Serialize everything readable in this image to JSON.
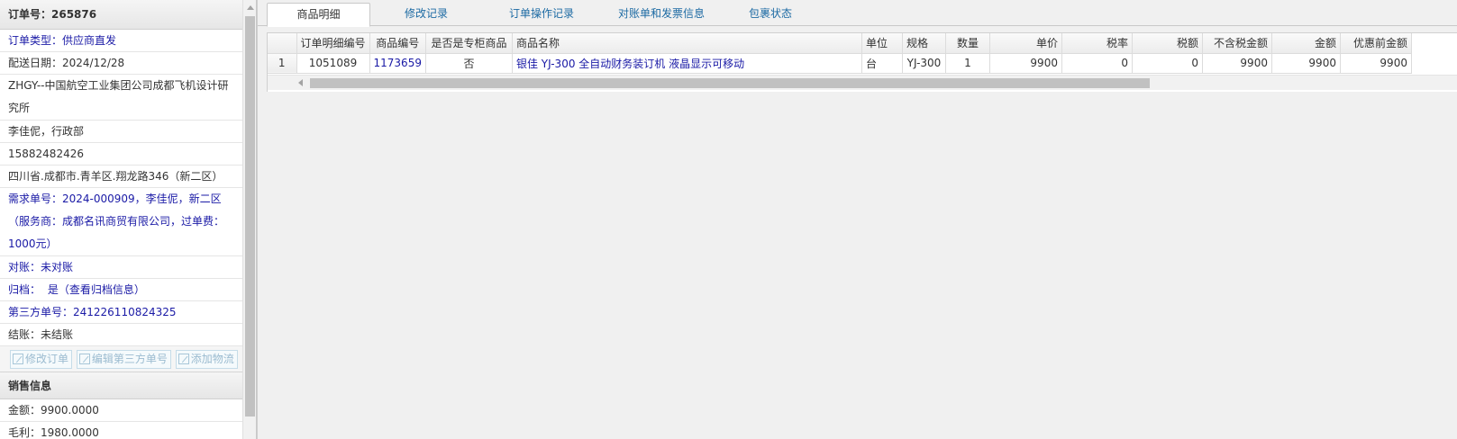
{
  "left": {
    "order_number": "订单号：265876",
    "order_type": "订单类型：供应商直发",
    "delivery_date": "配送日期：2024/12/28",
    "company": "ZHGY--中国航空工业集团公司成都飞机设计研究所",
    "contact": "李佳伲，行政部",
    "phone": "15882482426",
    "address": "四川省.成都市.青羊区.翔龙路346（新二区）",
    "demand": "需求单号：2024-000909，李佳伲，新二区（服务商：成都名讯商贸有限公司，过单费：1000元）",
    "reconcile": "对账：未对账",
    "archive_label": "归档：",
    "archive_value": "是（查看归档信息）",
    "third_party": "第三方单号：241226110824325",
    "settlement": "结账：未结账",
    "buttons": {
      "edit_order": "修改订单",
      "edit_third_party": "编辑第三方单号",
      "add_logistics": "添加物流"
    },
    "sales_section": "销售信息",
    "amount": "金额：9900.0000",
    "profit_partial": "毛利：1980.0000"
  },
  "tabs": [
    "商品明细",
    "修改记录",
    "订单操作记录",
    "对账单和发票信息",
    "包裹状态"
  ],
  "table": {
    "columns": [
      "",
      "订单明细编号",
      "商品编号",
      "是否是专柜商品",
      "商品名称",
      "单位",
      "规格",
      "数量",
      "单价",
      "税率",
      "税额",
      "不含税金额",
      "金额",
      "优惠前金额"
    ],
    "rows": [
      [
        "1",
        "1051089",
        "1173659",
        "否",
        "银佳 YJ-300 全自动财务装订机 液晶显示可移动",
        "台",
        "YJ-300",
        "1",
        "9900",
        "0",
        "0",
        "9900",
        "9900",
        "9900"
      ]
    ]
  }
}
